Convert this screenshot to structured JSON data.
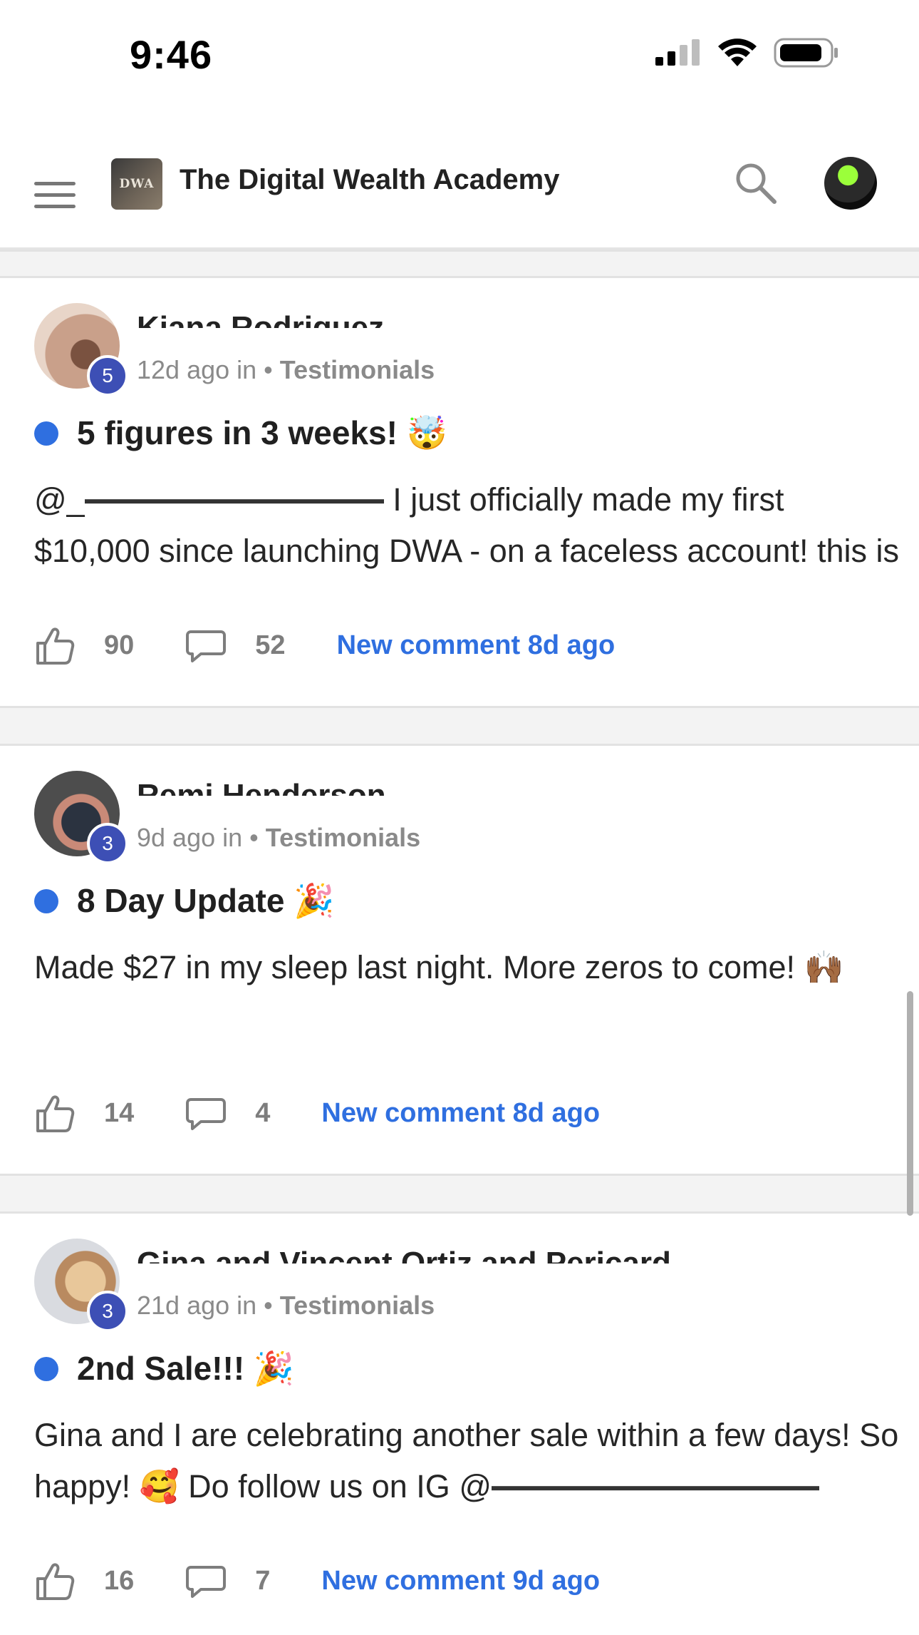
{
  "status_bar": {
    "time": "9:46"
  },
  "header": {
    "app_title": "The Digital Wealth Academy",
    "logo_text": "DWA"
  },
  "posts": [
    {
      "author": "Kiana Rodriguez",
      "level": "5",
      "time": "12d ago in",
      "category": "Testimonials",
      "title": "5 figures in 3 weeks! 🤯",
      "body_prefix": "@_",
      "body": "I just officially made my first $10,000 since launching DWA - on a faceless account! this is",
      "likes": "90",
      "comments": "52",
      "new_comment": "New comment 8d ago"
    },
    {
      "author": "Remi Henderson",
      "level": "3",
      "time": "9d ago in",
      "category": "Testimonials",
      "title": "8 Day Update 🎉",
      "body_prefix": "",
      "body": "Made $27 in my sleep last night. More zeros to come! 🙌🏾",
      "likes": "14",
      "comments": "4",
      "new_comment": "New comment 8d ago"
    },
    {
      "author": "Gina and Vincent Ortiz and Pericard",
      "level": "3",
      "time": "21d ago in",
      "category": "Testimonials",
      "title": "2nd Sale!!! 🎉",
      "body_prefix": "",
      "body": "Gina and I are celebrating another sale within a few days! So happy! 🥰 Do follow us on IG @",
      "likes": "16",
      "comments": "7",
      "new_comment": "New comment 9d ago"
    }
  ],
  "colors": {
    "accent": "#2f6fe0",
    "badge": "#3d4fb5"
  }
}
